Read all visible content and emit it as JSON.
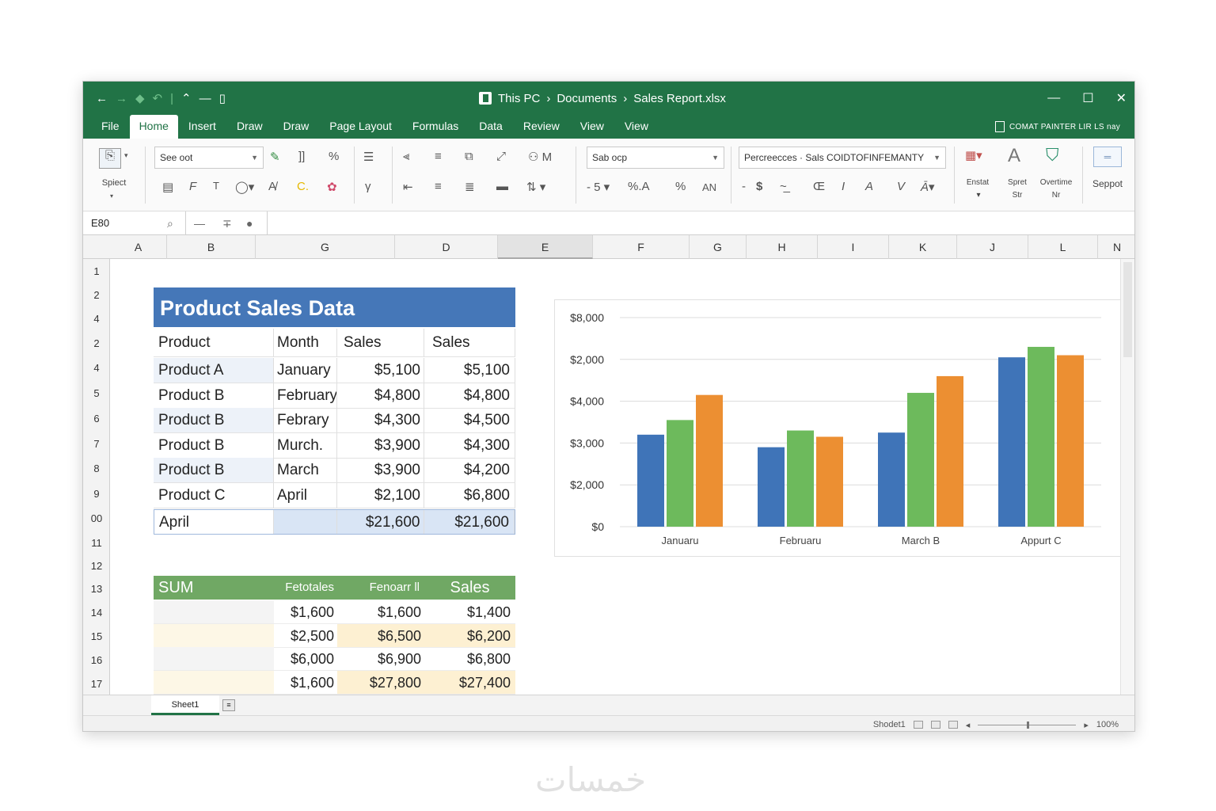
{
  "window": {
    "title_path": [
      "This PC",
      "Documents",
      "Sales Report.xlsx"
    ],
    "controls": [
      "—",
      "☐",
      "✕"
    ]
  },
  "ribbon_tabs": [
    "File",
    "Home",
    "Insert",
    "Draw",
    "Draw",
    "Page Layout",
    "Formulas",
    "Data",
    "Review",
    "View",
    "View"
  ],
  "active_tab": "Home",
  "tab_right_label": "COMAT PAINTER LIR LS nay",
  "ribbon": {
    "paste_label": "Spiect",
    "font_combo": "See oot",
    "font_size_combo": "Sab ocp",
    "style_combo": "Percreecces · Sals COIDTOFINFEMANTY",
    "number_format_value": "5",
    "percent_symbols": [
      "%.A",
      "%",
      "AN"
    ],
    "insert_label": "Enstat",
    "format_label": "Spret",
    "format_sub": "Str",
    "overtime_label": "Overtime",
    "overtime_sub": "Nr",
    "support_label": "Seppot"
  },
  "formula_bar": {
    "name_box": "E80",
    "content": ""
  },
  "columns": [
    "A",
    "B",
    "G",
    "D",
    "E",
    "F",
    "G",
    "H",
    "I",
    "K",
    "J",
    "L",
    "N"
  ],
  "selected_column": "E",
  "rows": [
    "1",
    "2",
    "4",
    "2",
    "4",
    "5",
    "6",
    "7",
    "8",
    "9",
    "00",
    "11",
    "12",
    "13",
    "14",
    "15",
    "16",
    "17"
  ],
  "product_table": {
    "title": "Product Sales Data",
    "headers": [
      "Product",
      "Month",
      "Sales",
      "Sales"
    ],
    "rows": [
      [
        "Product A",
        "January",
        "$5,100",
        "$5,100"
      ],
      [
        "Product B",
        "February",
        "$4,800",
        "$4,800"
      ],
      [
        "Product B",
        "Febrary",
        "$4,300",
        "$4,500"
      ],
      [
        "Product B",
        "Murch.",
        "$3,900",
        "$4,300"
      ],
      [
        "Product B",
        "March",
        "$3,900",
        "$4,200"
      ],
      [
        "Product C",
        "April",
        "$2,100",
        "$6,800"
      ]
    ],
    "total": [
      "April",
      "",
      "$21,600",
      "$21,600"
    ]
  },
  "sum_table": {
    "headers": [
      "SUM",
      "Fetotales",
      "Fenoarr  ll",
      "Sales"
    ],
    "rows": [
      [
        "",
        "$1,600",
        "$1,600",
        "$1,400"
      ],
      [
        "",
        "$2,500",
        "$6,500",
        "$6,200"
      ],
      [
        "",
        "$6,000",
        "$6,900",
        "$6,800"
      ],
      [
        "",
        "$1,600",
        "$27,800",
        "$27,400"
      ]
    ]
  },
  "chart_data": {
    "type": "bar",
    "categories": [
      "Januaru",
      "Februaru",
      "March B",
      "Appurt C"
    ],
    "y_tick_labels": [
      "$0",
      "$2,000",
      "$3,000",
      "$4,000",
      "$2,000",
      "$8,000"
    ],
    "ylim": [
      0,
      5
    ],
    "grid": true,
    "series": [
      {
        "color": "#3f74b8",
        "values": [
          2.2,
          1.9,
          2.25,
          4.05
        ]
      },
      {
        "color": "#6dba5c",
        "values": [
          2.55,
          2.3,
          3.2,
          4.3
        ]
      },
      {
        "color": "#ec8f32",
        "values": [
          3.15,
          2.15,
          3.6,
          4.1
        ]
      }
    ]
  },
  "sheet_tab": "Sheet1",
  "status": {
    "sheet_name": "Shodet1",
    "zoom": "100%"
  },
  "watermark": "خمسات"
}
